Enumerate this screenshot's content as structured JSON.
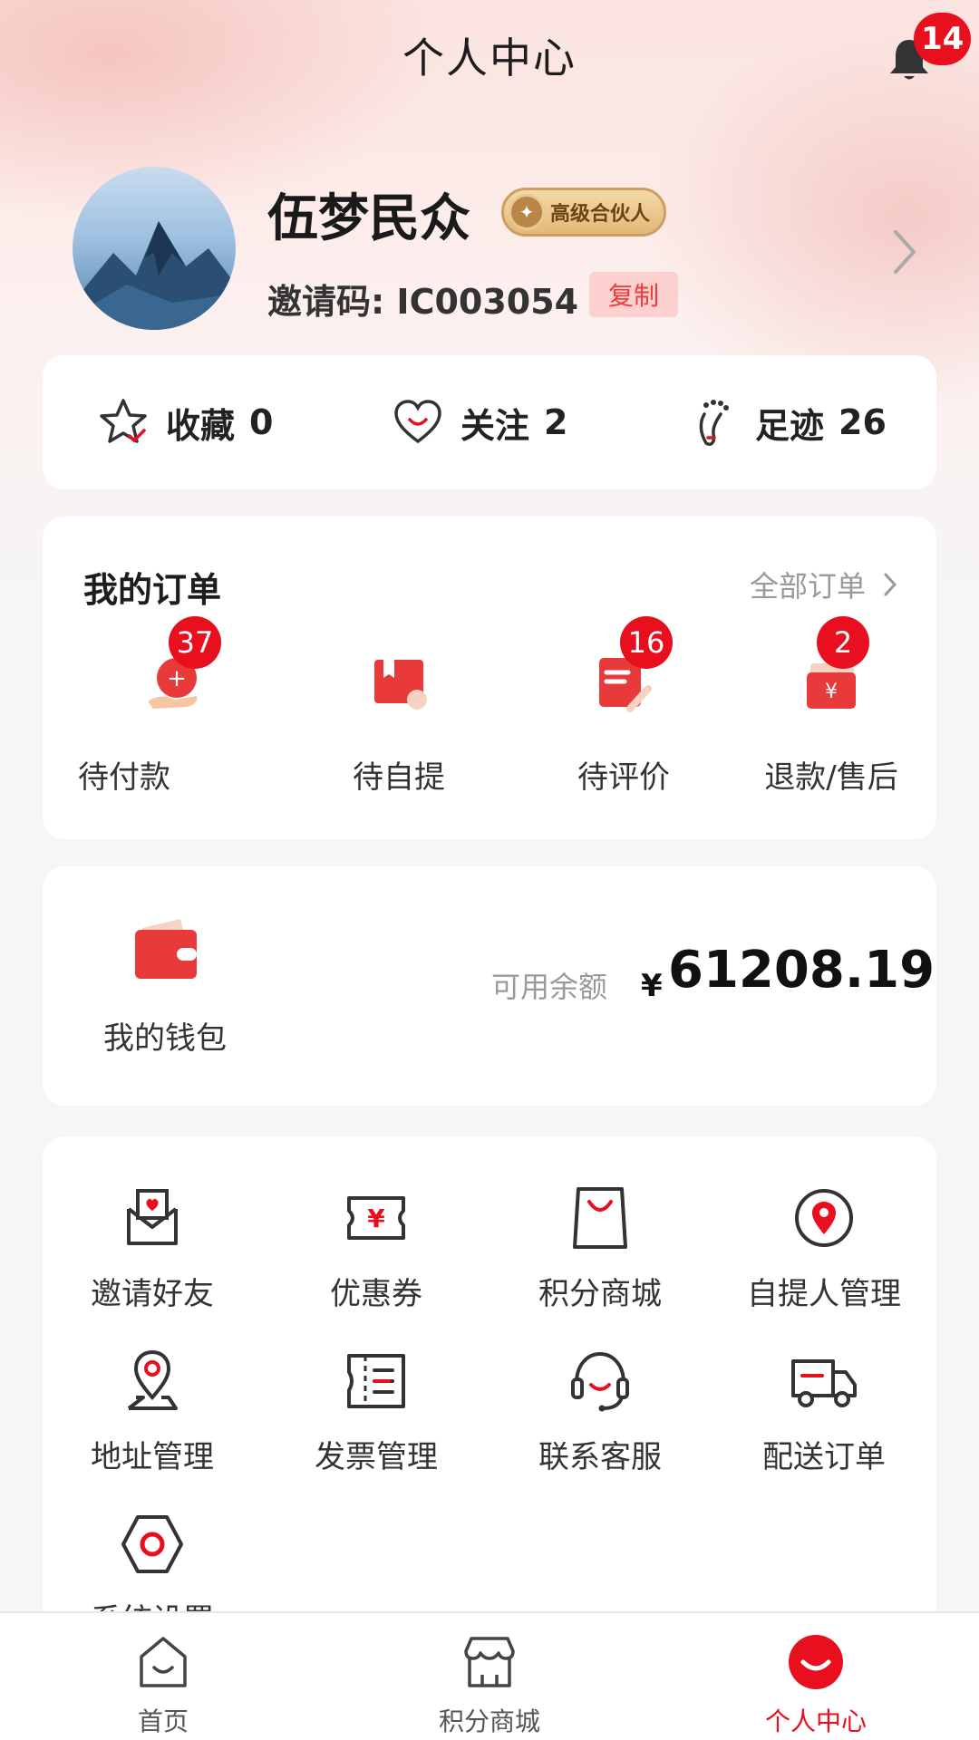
{
  "header": {
    "title": "个人中心",
    "notification_count": "14"
  },
  "profile": {
    "nickname": "伍梦民众",
    "level": "高级合伙人",
    "invite_code_label": "邀请码: IC003054",
    "copy_label": "复制"
  },
  "stats": [
    {
      "label": "收藏",
      "value": "0",
      "icon": "star-icon"
    },
    {
      "label": "关注",
      "value": "2",
      "icon": "heart-icon"
    },
    {
      "label": "足迹",
      "value": "26",
      "icon": "footprint-icon"
    }
  ],
  "orders": {
    "title": "我的订单",
    "all_label": "全部订单",
    "items": [
      {
        "label": "待付款",
        "badge": "37",
        "icon": "pending-payment-icon"
      },
      {
        "label": "待自提",
        "badge": "",
        "icon": "pickup-icon"
      },
      {
        "label": "待评价",
        "badge": "16",
        "icon": "review-icon"
      },
      {
        "label": "退款/售后",
        "badge": "2",
        "icon": "refund-icon"
      }
    ]
  },
  "wallet": {
    "label": "我的钱包",
    "balance_label": "可用余额",
    "currency": "¥",
    "balance": "61208.19"
  },
  "services": [
    {
      "label": "邀请好友",
      "icon": "invite-envelope-icon"
    },
    {
      "label": "优惠券",
      "icon": "coupon-icon"
    },
    {
      "label": "积分商城",
      "icon": "shopping-bag-icon"
    },
    {
      "label": "自提人管理",
      "icon": "location-pin-icon"
    },
    {
      "label": "地址管理",
      "icon": "address-pin-icon"
    },
    {
      "label": "发票管理",
      "icon": "invoice-icon"
    },
    {
      "label": "联系客服",
      "icon": "headset-icon"
    },
    {
      "label": "配送订单",
      "icon": "delivery-truck-icon"
    },
    {
      "label": "系统设置",
      "icon": "settings-hexagon-icon"
    }
  ],
  "tabbar": [
    {
      "label": "首页",
      "icon": "home-icon",
      "active": false
    },
    {
      "label": "积分商城",
      "icon": "store-icon",
      "active": false
    },
    {
      "label": "个人中心",
      "icon": "profile-smile-icon",
      "active": true
    }
  ],
  "colors": {
    "accent": "#e8101e",
    "background": "#f6f6f6",
    "card": "#ffffff"
  }
}
